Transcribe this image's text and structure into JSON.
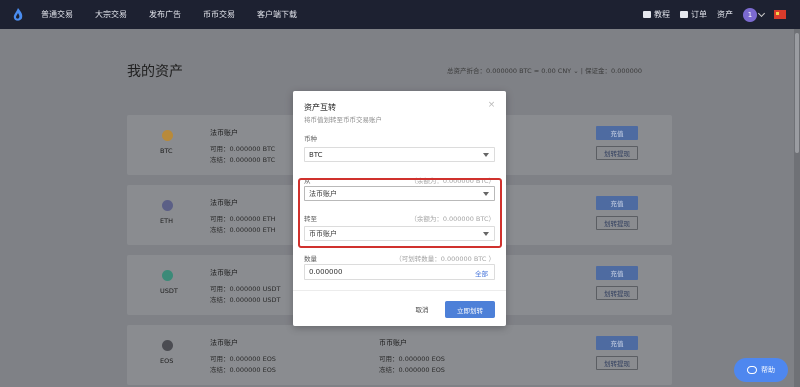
{
  "nav": {
    "items": [
      "普通交易",
      "大宗交易",
      "发布广告",
      "币币交易",
      "客户端下载"
    ],
    "tutorial": "教程",
    "orders": "订单",
    "assets": "资产",
    "avatar_initial": "1"
  },
  "page": {
    "title": "我的资产",
    "summary": "总资产折合：0.000000 BTC ≈ 0.00  CNY  ⌄  |  保证金：0.000000"
  },
  "assets": [
    {
      "coin": "BTC",
      "color": "#b88a3a",
      "account": "法币账户",
      "available": "可用：0.000000 BTC",
      "frozen": "冻结：0.000000 BTC",
      "account2": "",
      "available2": "",
      "frozen2": "",
      "btn_primary": "充值",
      "btn_secondary": "划转提现"
    },
    {
      "coin": "ETH",
      "color": "#5b5f86",
      "account": "法币账户",
      "available": "可用：0.000000 ETH",
      "frozen": "冻结：0.000000 ETH",
      "account2": "",
      "available2": "",
      "frozen2": "",
      "btn_primary": "充值",
      "btn_secondary": "划转提现"
    },
    {
      "coin": "USDT",
      "color": "#3b8a78",
      "account": "法币账户",
      "available": "可用：0.000000 USDT",
      "frozen": "冻结：0.000000 USDT",
      "account2": "",
      "available2": "",
      "frozen2": "",
      "btn_primary": "充值",
      "btn_secondary": "划转提现"
    },
    {
      "coin": "EOS",
      "color": "#4b4c52",
      "account": "法币账户",
      "available": "可用：0.000000 EOS",
      "frozen": "冻结：0.000000 EOS",
      "account2": "币币账户",
      "available2": "可用：0.000000 EOS",
      "frozen2": "冻结：0.000000 EOS",
      "btn_primary": "充值",
      "btn_secondary": "划转提现"
    }
  ],
  "modal": {
    "title": "资产互转",
    "subtitle": "将币值划转至币币交易账户",
    "currency_label": "币种",
    "currency_value": "BTC",
    "from_label": "从",
    "from_hint": "（余额为：0.000000 BTC）",
    "from_value": "法币账户",
    "to_label": "转至",
    "to_hint": "（余额为：0.000000 BTC）",
    "to_value": "币币账户",
    "amount_label": "数量",
    "amount_hint": "（可划转数量：0.000000 BTC ）",
    "amount_value": "0.000000",
    "all_label": "全部",
    "cancel_label": "取消",
    "confirm_label": "立即划转"
  },
  "help": {
    "label": "帮助"
  }
}
